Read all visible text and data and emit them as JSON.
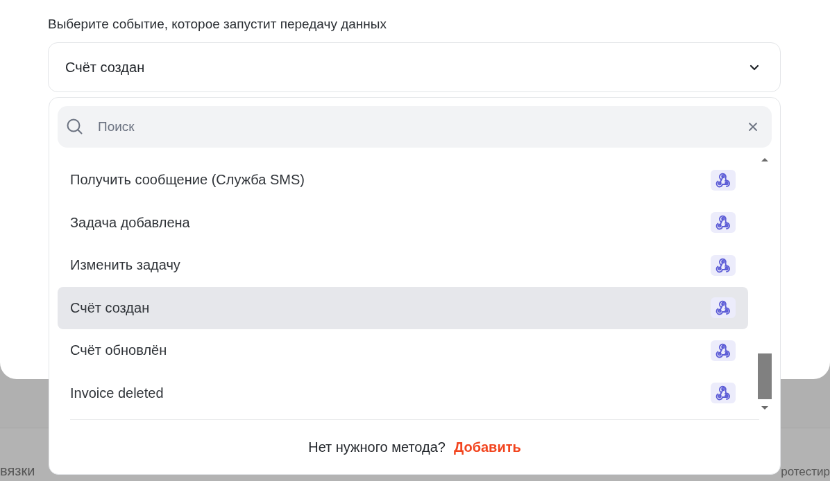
{
  "field_label": "Выберите событие, которое запустит передачу данных",
  "select": {
    "value": "Счёт создан"
  },
  "search": {
    "placeholder": "Поиск"
  },
  "options": [
    {
      "label": "Получить сообщение (Служба SMS)",
      "selected": false
    },
    {
      "label": "Задача добавлена",
      "selected": false
    },
    {
      "label": "Изменить задачу",
      "selected": false
    },
    {
      "label": "Счёт создан",
      "selected": true
    },
    {
      "label": "Счёт обновлён",
      "selected": false
    },
    {
      "label": "Invoice deleted",
      "selected": false
    }
  ],
  "footer": {
    "question": "Нет нужного метода?",
    "link": "Добавить"
  },
  "background_footer": {
    "left_text": "вязки",
    "right_text": "ротестир"
  }
}
